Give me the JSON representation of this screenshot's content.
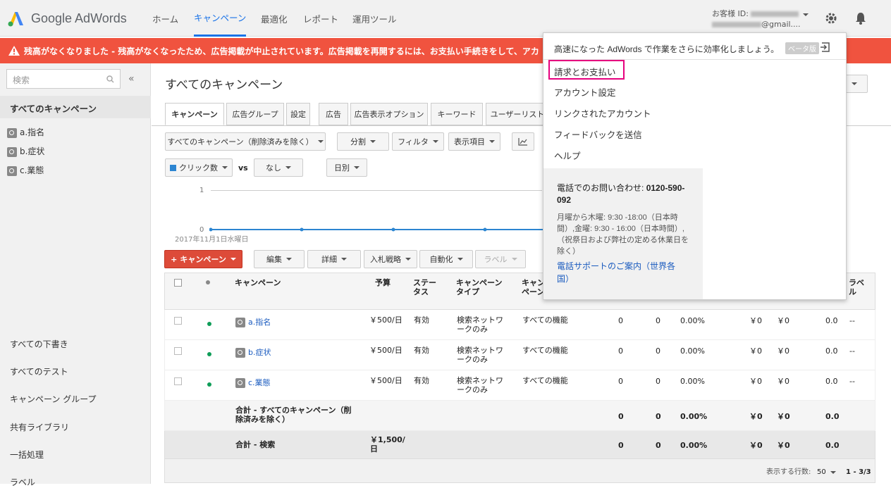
{
  "header": {
    "logo_text": "Google AdWords",
    "nav": [
      "ホーム",
      "キャンペーン",
      "最適化",
      "レポート",
      "運用ツール"
    ],
    "account_label": "お客様 ID:",
    "account_email_suffix": "@gmail....",
    "brand_blue": "#1a73e8"
  },
  "alert": {
    "text": "残高がなくなりました - 残高がなくなったため、広告掲載が中止されています。広告掲載を再開するには、お支払い手続きをして、アカ"
  },
  "sidebar": {
    "search_placeholder": "検索",
    "collapse": "«",
    "all_campaigns": "すべてのキャンペーン",
    "campaigns": [
      "a.指名",
      "b.症状",
      "c.業態"
    ],
    "bottom_items": [
      "すべての下書き",
      "すべてのテスト",
      "キャンペーン グループ",
      "共有ライブラリ",
      "一括処理",
      "ラベル"
    ]
  },
  "main": {
    "title": "すべてのキャンペーン",
    "tabs": [
      "キャンペーン",
      "広告グループ",
      "設定",
      "広告",
      "広告表示オプション",
      "キーワード",
      "ユーザーリスト"
    ],
    "toolbar": {
      "scope": "すべてのキャンペーン（削除済みを除く）",
      "segment": "分割",
      "filter": "フィルタ",
      "columns": "表示項目"
    },
    "chart_controls": {
      "metric": "クリック数",
      "vs": "vs",
      "compare": "なし",
      "period": "日別"
    },
    "chart": {
      "y_max": "1",
      "y_min": "0",
      "date": "2017年11月1日水曜日"
    },
    "actions": {
      "add": "キャンペーン",
      "edit": "編集",
      "details": "詳細",
      "bid": "入札戦略",
      "automate": "自動化",
      "labels": "ラベル"
    },
    "table": {
      "headers": {
        "campaign": "キャンペーン",
        "budget": "予算",
        "status": "ステータス",
        "type": "キャンペーンタイプ",
        "subtype": "キャンペーンプタイ",
        "labels": "ラベル"
      },
      "rows": [
        {
          "name": "a.指名",
          "budget": "￥500/日",
          "status": "有効",
          "type": "検索ネットワークのみ",
          "subtype": "すべての機能",
          "c1": "0",
          "c2": "0",
          "ctr": "0.00%",
          "cpc": "￥0",
          "cost": "￥0",
          "pos": "0.0",
          "label": "--"
        },
        {
          "name": "b.症状",
          "budget": "￥500/日",
          "status": "有効",
          "type": "検索ネットワークのみ",
          "subtype": "すべての機能",
          "c1": "0",
          "c2": "0",
          "ctr": "0.00%",
          "cpc": "￥0",
          "cost": "￥0",
          "pos": "0.0",
          "label": "--"
        },
        {
          "name": "c.業態",
          "budget": "￥500/日",
          "status": "有効",
          "type": "検索ネットワークのみ",
          "subtype": "すべての機能",
          "c1": "0",
          "c2": "0",
          "ctr": "0.00%",
          "cpc": "￥0",
          "cost": "￥0",
          "pos": "0.0",
          "label": "--"
        }
      ],
      "total_all": {
        "label": "合計 - すべてのキャンペーン（削除済みを除く）",
        "c1": "0",
        "c2": "0",
        "ctr": "0.00%",
        "cpc": "￥0",
        "cost": "￥0",
        "pos": "0.0"
      },
      "total_search": {
        "label": "合計 - 検索",
        "budget": "￥1,500/日",
        "c1": "0",
        "c2": "0",
        "ctr": "0.00%",
        "cpc": "￥0",
        "cost": "￥0",
        "pos": "0.0"
      },
      "pager": {
        "rows_label": "表示する行数:",
        "rows_value": "50",
        "range": "1 - 3/3"
      }
    }
  },
  "dropdown": {
    "promo": "高速になった AdWords で作業をさらに効率化しましょう。",
    "beta": "ベータ版",
    "items": [
      "請求とお支払い",
      "アカウント設定",
      "リンクされたアカウント",
      "フィードバックを送信",
      "ヘルプ"
    ],
    "phone_label": "電話でのお問い合わせ:",
    "phone_number": "0120-590-092",
    "hours": "月曜から木曜: 9:30 -18:00（日本時間）,金曜: 9:30 - 16:00（日本時間）,（祝祭日および弊社の定める休業日を除く）",
    "support_link": "電話サポートのご案内（世界各国）",
    "highlight_color": "#e6007e"
  }
}
